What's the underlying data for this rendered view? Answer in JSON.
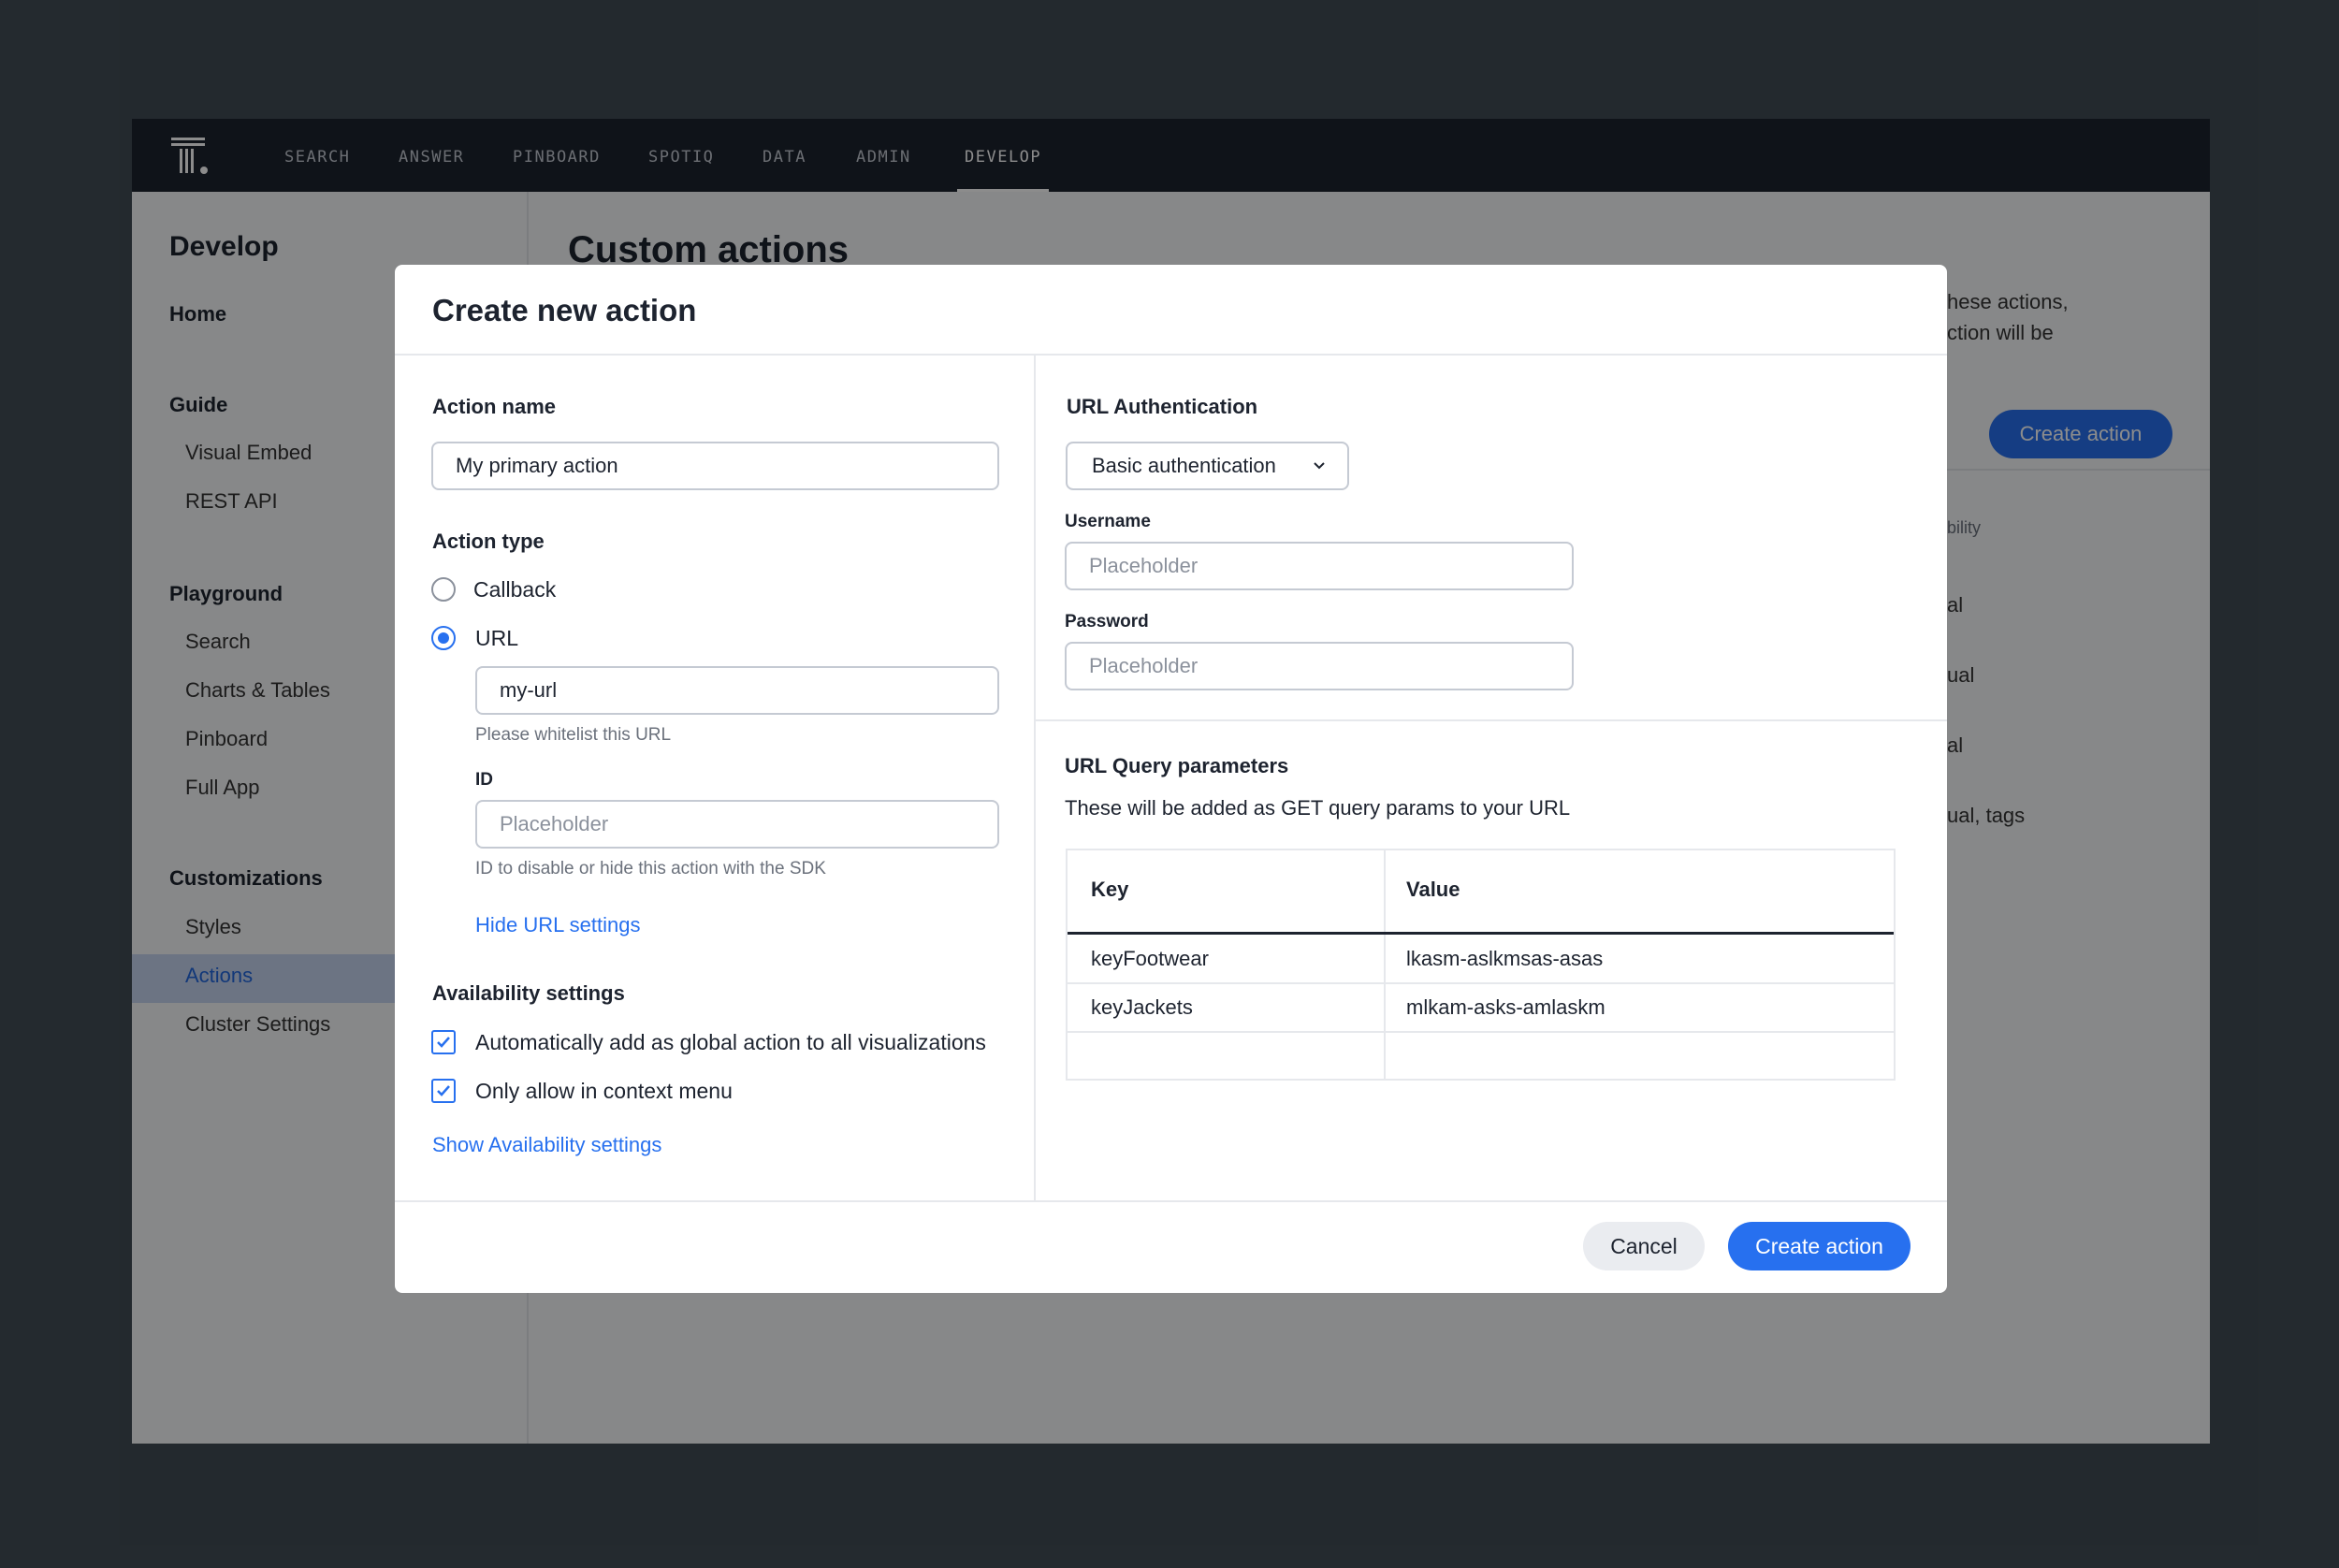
{
  "nav": {
    "items": [
      "SEARCH",
      "ANSWER",
      "PINBOARD",
      "SPOTIQ",
      "DATA",
      "ADMIN",
      "DEVELOP"
    ],
    "active": "DEVELOP"
  },
  "sidebar": {
    "title": "Develop",
    "home": "Home",
    "guide": {
      "label": "Guide",
      "items": [
        "Visual Embed",
        "REST API"
      ]
    },
    "playground": {
      "label": "Playground",
      "items": [
        "Search",
        "Charts & Tables",
        "Pinboard",
        "Full App"
      ]
    },
    "customizations": {
      "label": "Customizations",
      "items": [
        "Styles",
        "Actions",
        "Cluster Settings"
      ]
    },
    "selected": "Actions"
  },
  "main": {
    "title": "Custom actions",
    "partial_line1": "hese actions,",
    "partial_line2": "ction will be",
    "create_button": "Create action",
    "col_partial": "bility",
    "rows_partial": [
      "al",
      "ual",
      "al",
      "ual, tags"
    ]
  },
  "modal": {
    "title": "Create new action",
    "action_name_label": "Action name",
    "action_name_value": "My primary action",
    "action_type_label": "Action type",
    "option_callback": "Callback",
    "option_url": "URL",
    "url_value": "my-url",
    "url_help": "Please whitelist this URL",
    "id_label": "ID",
    "id_placeholder": "Placeholder",
    "id_help": "ID to disable or hide this action with the SDK",
    "hide_url_settings": "Hide URL settings",
    "availability_label": "Availability settings",
    "check_global": "Automatically add as global action to all visualizations",
    "check_context": "Only allow in context menu",
    "show_availability": "Show Availability settings",
    "url_auth_label": "URL Authentication",
    "auth_select": "Basic authentication",
    "username_label": "Username",
    "username_placeholder": "Placeholder",
    "password_label": "Password",
    "password_placeholder": "Placeholder",
    "query_label": "URL Query parameters",
    "query_desc": "These will be added as GET query params to your URL",
    "table_headers": [
      "Key",
      "Value"
    ],
    "table_rows": [
      [
        "keyFootwear",
        "lkasm-aslkmsas-asas"
      ],
      [
        "keyJackets",
        "mlkam-asks-amlaskm"
      ]
    ],
    "cancel": "Cancel",
    "submit": "Create action"
  },
  "colors": {
    "accent": "#2770ef",
    "nav_bg": "#1d232f",
    "backdrop": "#414c55"
  }
}
